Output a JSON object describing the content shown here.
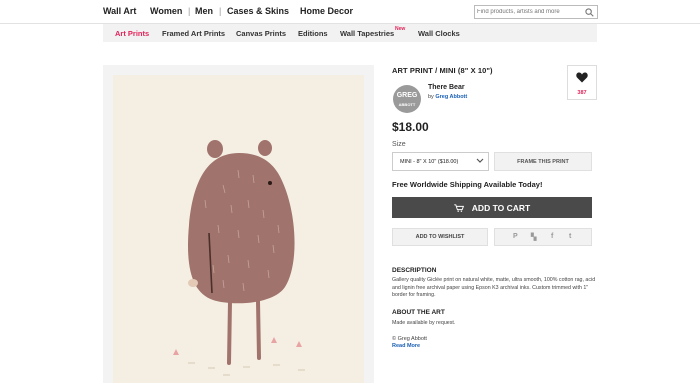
{
  "topnav": {
    "items": [
      "Wall Art",
      "Women",
      "Men",
      "Cases & Skins",
      "Home Decor"
    ],
    "separator": "|",
    "search_placeholder": "Find products, artists and more"
  },
  "subnav": {
    "items": [
      "Art Prints",
      "Framed Art Prints",
      "Canvas Prints",
      "Editions",
      "Wall Tapestries",
      "Wall Clocks"
    ],
    "new_badge": "New",
    "active": "Art Prints"
  },
  "product": {
    "type_title": "ART PRINT / MINI (8\" X 10\")",
    "work_title": "There Bear",
    "by_prefix": "by",
    "artist": "Greg Abbott",
    "avatar_line1": "GREG",
    "avatar_line2": "ABBOTT",
    "favorites_count": "387",
    "price": "$18.00",
    "size_label": "Size",
    "size_value": "MINI - 8\" X 10\" ($18.00)",
    "frame_button": "FRAME THIS PRINT",
    "shipping": "Free Worldwide Shipping Available Today!",
    "cart_button": "ADD TO CART",
    "wishlist_button": "ADD TO WISHLIST",
    "share_icons": [
      "P",
      "▚",
      "f",
      "t"
    ],
    "description_title": "DESCRIPTION",
    "description": "Gallery quality Giclée print on natural white, matte, ultra smooth, 100% cotton rag, acid and lignin free archival paper using Epson K3 archival inks. Custom trimmed with 1\" border for framing.",
    "about_title": "ABOUT THE ART",
    "about_text": "Made available by request.",
    "copyright": "© Greg Abbott",
    "read_more": "Read More"
  },
  "colors": {
    "accent": "#e2235a",
    "link": "#1a5fb4",
    "cart_bg": "#4a4a4a",
    "bear": "#a0736c",
    "art_bg": "#f5efe3"
  }
}
